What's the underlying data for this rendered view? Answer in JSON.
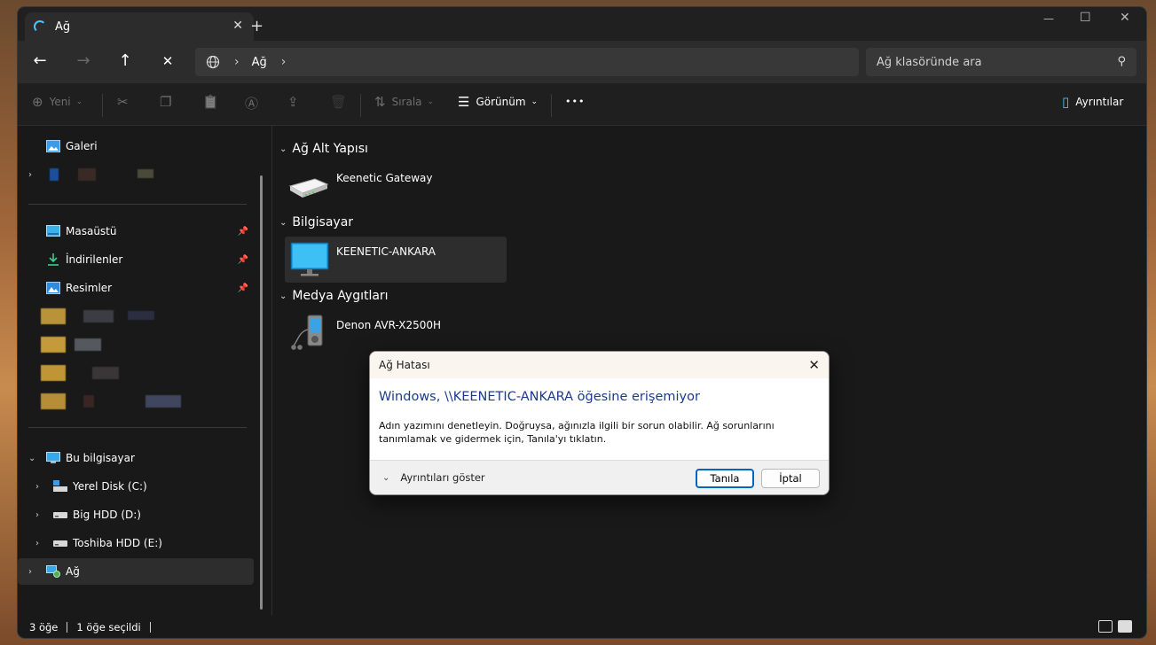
{
  "window": {
    "tab_title": "Ağ",
    "tab_close": "✕",
    "new_tab": "+",
    "controls": {
      "minimize": "—",
      "maximize": "☐",
      "close": "✕"
    }
  },
  "nav": {
    "back": "←",
    "forward": "→",
    "up": "↑",
    "stop": "✕",
    "breadcrumb_sep": "›",
    "breadcrumb": "Ağ",
    "breadcrumb_tail": "›",
    "search_placeholder": "Ağ klasöründe ara",
    "search_icon": "⚲"
  },
  "toolbar": {
    "new_label": "Yeni",
    "sort_label": "Sırala",
    "view_label": "Görünüm",
    "more_label": "•••",
    "details_label": "Ayrıntılar",
    "icons": {
      "new": "⊕",
      "cut": "✂",
      "copy": "❐",
      "paste": "📋",
      "rename": "Ⓐ",
      "share": "⇪",
      "delete": "🗑",
      "sort": "⇅",
      "view": "☰",
      "details": "▯"
    }
  },
  "sidebar": {
    "gallery": "Galeri",
    "desktop": "Masaüstü",
    "downloads": "İndirilenler",
    "pictures": "Resimler",
    "this_pc": "Bu bilgisayar",
    "drive_c": "Yerel Disk (C:)",
    "drive_d": "Big HDD (D:)",
    "drive_e": "Toshiba HDD (E:)",
    "network": "Ağ",
    "pin": "📌"
  },
  "content": {
    "groups": [
      {
        "header": "Ağ Alt Yapısı",
        "item": "Keenetic Gateway"
      },
      {
        "header": "Bilgisayar",
        "item": "KEENETIC-ANKARA"
      },
      {
        "header": "Medya Aygıtları",
        "item": "Denon AVR-X2500H"
      }
    ]
  },
  "status": {
    "count": "3 öğe",
    "selected": "1 öğe seçildi"
  },
  "dialog": {
    "title": "Ağ Hatası",
    "close": "✕",
    "heading": "Windows, \\\\KEENETIC-ANKARA öğesine erişemiyor",
    "body": "Adın yazımını denetleyin. Doğruysa, ağınızla ilgili bir sorun olabilir. Ağ sorunlarını tanımlamak ve gidermek için, Tanıla'yı tıklatın.",
    "details": "Ayrıntıları göster",
    "primary": "Tanıla",
    "secondary": "İptal"
  },
  "colors": {
    "accent": "#4cc2ff",
    "dialog_heading": "#1a3b8c",
    "primary_border": "#0067c0"
  }
}
